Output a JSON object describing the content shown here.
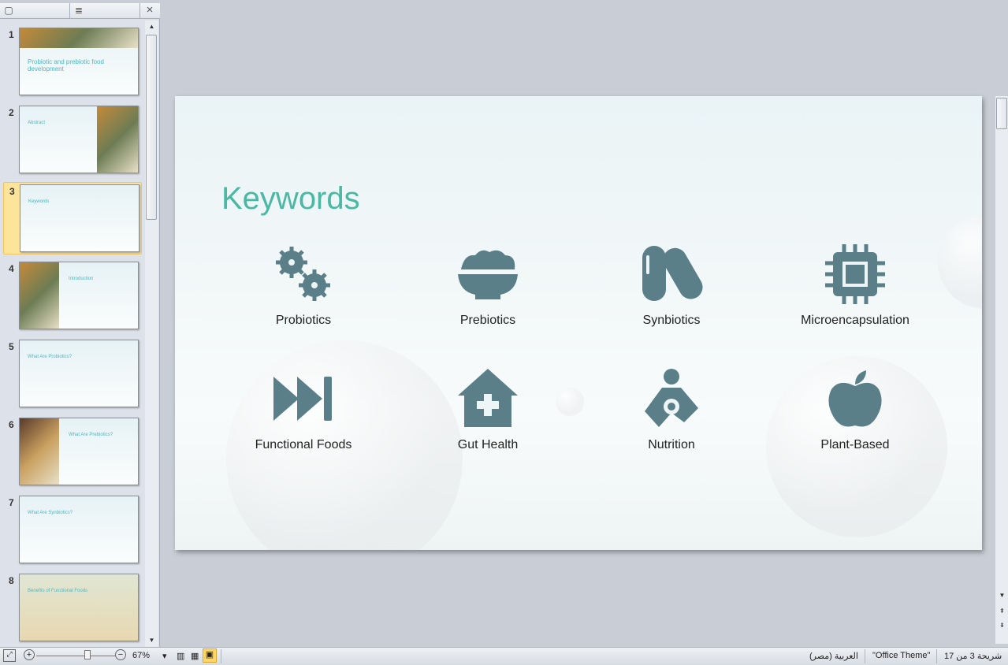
{
  "panel": {
    "close_icon": "×",
    "outline_icon": "≣"
  },
  "thumbnails": [
    {
      "num": "1",
      "title": "Probiotic and prebiotic food development"
    },
    {
      "num": "2",
      "title": "Abstract"
    },
    {
      "num": "3",
      "title": "Keywords"
    },
    {
      "num": "4",
      "title": "Introduction"
    },
    {
      "num": "5",
      "title": "What Are Probiotics?"
    },
    {
      "num": "6",
      "title": "What Are Prebiotics?"
    },
    {
      "num": "7",
      "title": "What Are Synbiotics?"
    },
    {
      "num": "8",
      "title": "Benefits of Functional Foods"
    }
  ],
  "slide": {
    "title": "Keywords",
    "icon_color": "#5a7f89",
    "title_color": "#4bb8a4",
    "keywords": [
      {
        "label": "Probiotics",
        "icon": "bacteria-icon"
      },
      {
        "label": "Prebiotics",
        "icon": "bowl-icon"
      },
      {
        "label": "Synbiotics",
        "icon": "pills-icon"
      },
      {
        "label": "Microencapsulation",
        "icon": "chip-icon"
      },
      {
        "label": "Functional  Foods",
        "icon": "fast-forward-icon"
      },
      {
        "label": "Gut Health",
        "icon": "house-medical-icon"
      },
      {
        "label": "Nutrition",
        "icon": "person-holding-heart-icon"
      },
      {
        "label": "Plant-Based",
        "icon": "apple-icon"
      }
    ]
  },
  "status": {
    "zoom": "67%",
    "slide_counter": "شريحة 3 من 17",
    "theme": "\"Office Theme\"",
    "language": "العربية (مصر)"
  }
}
